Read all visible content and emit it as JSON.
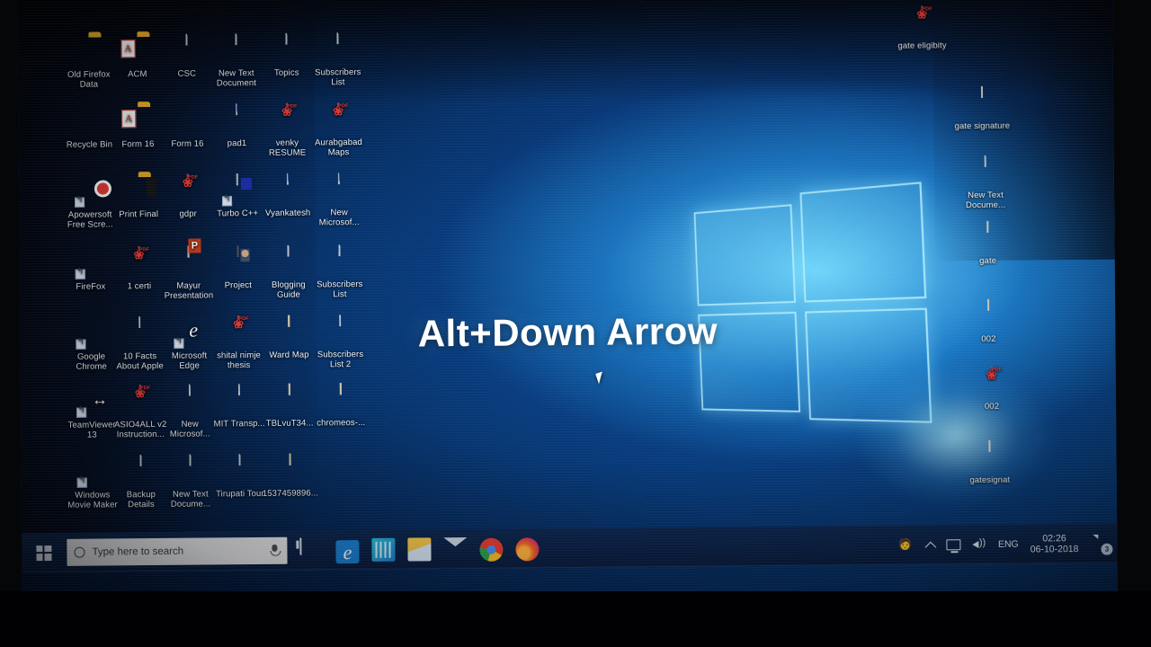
{
  "caption": "Alt+Down Arrow",
  "desktop": {
    "left_grid_columns": 6,
    "icons_left": [
      {
        "label": "Old Firefox Data",
        "type": "folder"
      },
      {
        "label": "ACM",
        "type": "folder-pdf"
      },
      {
        "label": "CSC",
        "type": "text-document"
      },
      {
        "label": "New Text Document",
        "type": "text-document"
      },
      {
        "label": "Topics",
        "type": "text-document"
      },
      {
        "label": "Subscribers List",
        "type": "excel"
      },
      {
        "label": "Recycle Bin",
        "type": "recycle-bin"
      },
      {
        "label": "Form 16",
        "type": "folder-pdf"
      },
      {
        "label": "Form 16",
        "type": "archive"
      },
      {
        "label": "pad1",
        "type": "word"
      },
      {
        "label": "venky RESUME",
        "type": "pdf"
      },
      {
        "label": "Aurabgabad Maps",
        "type": "pdf"
      },
      {
        "label": "Apowersoft Free Scre...",
        "type": "app-apowersoft"
      },
      {
        "label": "Print Final",
        "type": "folder-print"
      },
      {
        "label": "gdpr",
        "type": "pdf"
      },
      {
        "label": "Turbo C++",
        "type": "app-turbo"
      },
      {
        "label": "Vyankatesh",
        "type": "word"
      },
      {
        "label": "New Microsof...",
        "type": "word"
      },
      {
        "label": "FireFox",
        "type": "app-firefox"
      },
      {
        "label": "1 certi",
        "type": "pdf"
      },
      {
        "label": "Mayur Presentation",
        "type": "powerpoint"
      },
      {
        "label": "Project",
        "type": "image"
      },
      {
        "label": "Blogging Guide",
        "type": "text-document"
      },
      {
        "label": "Subscribers List",
        "type": "excel-a"
      },
      {
        "label": "Google Chrome",
        "type": "app-chrome"
      },
      {
        "label": "10 Facts About Apple",
        "type": "text-document"
      },
      {
        "label": "Microsoft Edge",
        "type": "app-edge"
      },
      {
        "label": "shital nimje thesis",
        "type": "pdf"
      },
      {
        "label": "Ward Map",
        "type": "image-tan"
      },
      {
        "label": "Subscribers List 2",
        "type": "excel-a"
      },
      {
        "label": "TeamViewer 13",
        "type": "app-teamviewer"
      },
      {
        "label": "ASIO4ALL v2 Instruction...",
        "type": "pdf"
      },
      {
        "label": "New Microsof...",
        "type": "excel"
      },
      {
        "label": "MIT Transp...",
        "type": "excel-a"
      },
      {
        "label": "TBLvuT34...",
        "type": "image-tan"
      },
      {
        "label": "chromeos-...",
        "type": "image-tan"
      },
      {
        "label": "Windows Movie Maker",
        "type": "app-moviemaker"
      },
      {
        "label": "Backup Details",
        "type": "text-document"
      },
      {
        "label": "New Text Docume...",
        "type": "text-document"
      },
      {
        "label": "Tirupati Tour",
        "type": "text-document"
      },
      {
        "label": "1537459896...",
        "type": "image-tan"
      }
    ],
    "icons_right": [
      {
        "label": "gate eligibity",
        "type": "pdf"
      },
      {
        "label": "gate signature",
        "type": "signature-image"
      },
      {
        "label": "New Text Docume...",
        "type": "text-document"
      },
      {
        "label": "gate",
        "type": "scan-image"
      },
      {
        "label": "002",
        "type": "scan-image"
      },
      {
        "label": "002",
        "type": "pdf"
      },
      {
        "label": "gatesignat",
        "type": "blank-image"
      }
    ]
  },
  "taskbar": {
    "start_label": "Start",
    "search_placeholder": "Type here to search",
    "search_value": "",
    "pinned": [
      {
        "name": "task-view",
        "label": "Task View"
      },
      {
        "name": "microsoft-edge",
        "label": "Microsoft Edge"
      },
      {
        "name": "microsoft-store",
        "label": "Microsoft Store"
      },
      {
        "name": "file-explorer",
        "label": "File Explorer"
      },
      {
        "name": "mail",
        "label": "Mail"
      },
      {
        "name": "google-chrome",
        "label": "Google Chrome"
      },
      {
        "name": "mozilla-firefox",
        "label": "Mozilla Firefox"
      }
    ],
    "tray": {
      "people_label": "People",
      "show_hidden_label": "Show hidden icons",
      "network_label": "Network",
      "volume_label": "Volume",
      "language": "ENG",
      "time": "02:26",
      "date": "06-10-2018",
      "notification_count": "3"
    }
  },
  "colors": {
    "accent": "#0b5fae",
    "taskbar": "#0d264e",
    "search_bg": "#e9eaec",
    "pdf_red": "#e23b3b",
    "excel_green": "#1d7044",
    "word_blue": "#1d4fa0",
    "caption_text": "#ffffff"
  }
}
